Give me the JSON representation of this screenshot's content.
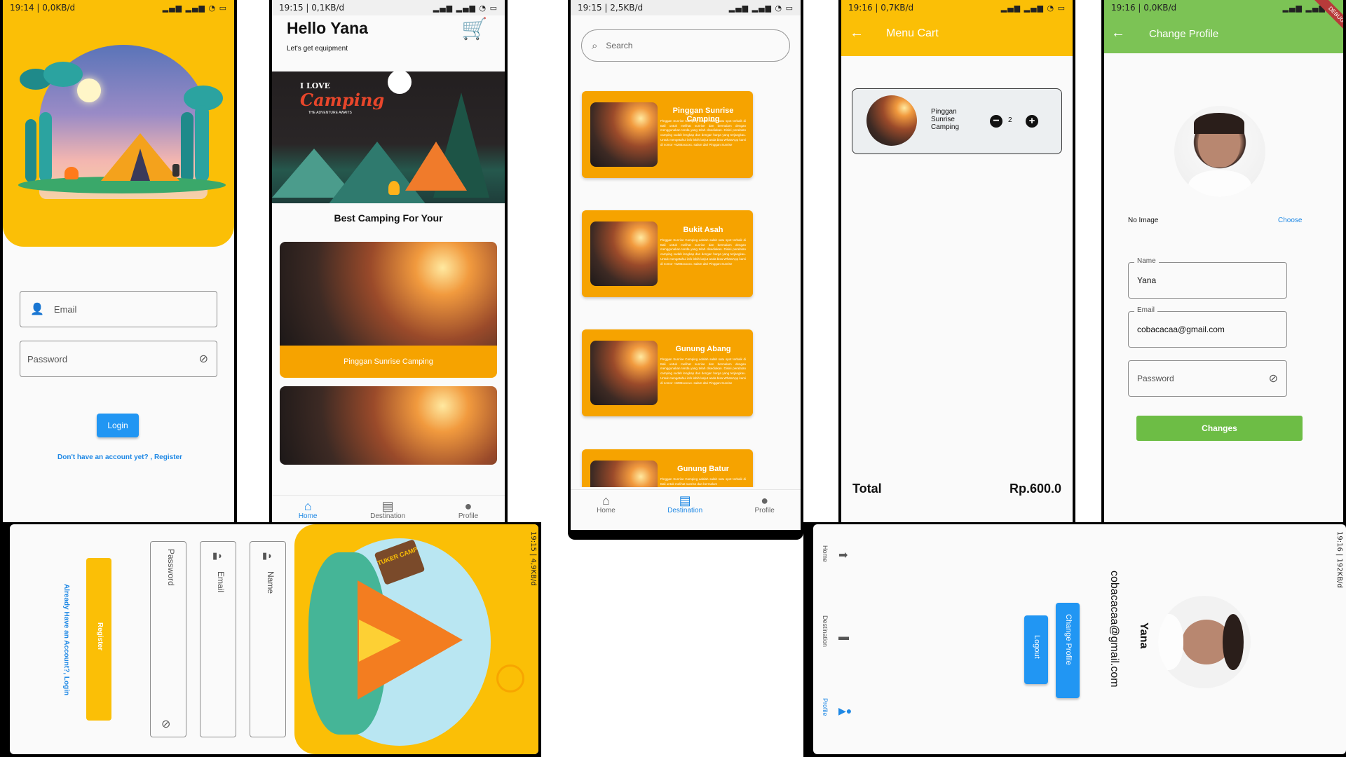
{
  "screens": {
    "login": {
      "status": "19:14 | 0,0KB/d",
      "battery": "26",
      "email_placeholder": "Email",
      "password_placeholder": "Password",
      "login_label": "Login",
      "register_link": "Don't have an account yet? , Register"
    },
    "home": {
      "status": "19:15 | 0,1KB/d",
      "battery": "25",
      "greeting": "Hello Yana",
      "subtitle": "Let's get equipment",
      "banner_line1": "I LOVE",
      "banner_line2": "Camping",
      "banner_line3": "THE ADVENTURE AWAITS",
      "section_title": "Best Camping For Your",
      "card1_label": "Pinggan Sunrise Camping",
      "nav": [
        "Home",
        "Destination",
        "Profile"
      ]
    },
    "destination": {
      "status": "19:15 | 2,5KB/d",
      "battery": "24",
      "search_placeholder": "Search",
      "cards": [
        {
          "title": "Pinggan Sunrise Camping",
          "desc": "Pinggan Sunrise Camping adalah salah satu spot terbaik di Bali untuk melihat sunrise dan bermalam dengan menggunakan tenda yang telah disediakan. Disini peralatan camping sudah lengkap dan dengan harga yang terjangkau. Untuk mengetahui info lebih lanjut anda bisa WhatsApp kami di nomor +6285xxxxxx. salam dari Pinggan Sunrise"
        },
        {
          "title": "Bukit Asah",
          "desc": "Pinggan Sunrise Camping adalah salah satu spot terbaik di Bali untuk melihat sunrise dan bermalam dengan menggunakan tenda yang telah disediakan. Disini peralatan camping sudah lengkap dan dengan harga yang terjangkau. Untuk mengetahui info lebih lanjut anda bisa WhatsApp kami di nomor +6285xxxxxx. salam dari Pinggan Sunrise"
        },
        {
          "title": "Gunung Abang",
          "desc": "Pinggan Sunrise Camping adalah salah satu spot terbaik di Bali untuk melihat sunrise dan bermalam dengan menggunakan tenda yang telah disediakan. Disini peralatan camping sudah lengkap dan dengan harga yang terjangkau. Untuk mengetahui info lebih lanjut anda bisa WhatsApp kami di nomor +6285xxxxxx. salam dari Pinggan Sunrise"
        },
        {
          "title": "Gunung Batur",
          "desc": "Pinggan Sunrise Camping adalah salah satu spot terbaik di Bali untuk melihat sunrise dan bermalam"
        }
      ],
      "nav": [
        "Home",
        "Destination",
        "Profile"
      ]
    },
    "cart": {
      "status": "19:16 | 0,7KB/d",
      "battery": "23",
      "title": "Menu Cart",
      "item_name": "Pinggan Sunrise Camping",
      "quantity": "2",
      "total_label": "Total",
      "total_value": "Rp.600.0"
    },
    "change_profile": {
      "status": "19:16 | 0,0KB/d",
      "title": "Change Profile",
      "debug_banner": "DEBUG",
      "no_image": "No Image",
      "choose": "Choose",
      "name_label": "Name",
      "name_value": "Yana",
      "email_label": "Email",
      "email_value": "cobacacaa@gmail.com",
      "password_placeholder": "Password",
      "changes_label": "Changes"
    },
    "register": {
      "status": "19:15 | 4,9KB/d",
      "name_placeholder": "Name",
      "email_placeholder": "Email",
      "password_placeholder": "Password",
      "register_label": "Register",
      "login_link": "Already Have an Account?, Login",
      "sign_text": "TUKER CAMP"
    },
    "profile": {
      "status": "19:16 | 192KB/d",
      "name": "Yana",
      "email": "cobacacaa@gmail.com",
      "change_profile_label": "Change Profile",
      "logout_label": "Logout",
      "nav": [
        "Home",
        "Destination",
        "Profile"
      ]
    }
  },
  "colors": {
    "yellow": "#fbbf06",
    "orange": "#f6a300",
    "blue": "#2196f3",
    "green": "#6dbd45"
  }
}
